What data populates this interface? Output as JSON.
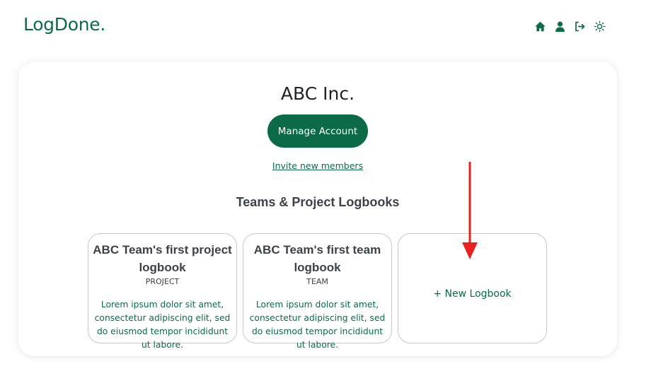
{
  "header": {
    "logo": "LogDone.",
    "nav": [
      {
        "icon": "home-icon"
      },
      {
        "icon": "user-icon"
      },
      {
        "icon": "logout-icon"
      },
      {
        "icon": "sun-icon"
      }
    ]
  },
  "org": {
    "name": "ABC Inc.",
    "manage_label": "Manage Account",
    "invite_label": "Invite new members"
  },
  "logbooks": {
    "section_title": "Teams & Project Logbooks",
    "items": [
      {
        "title": "ABC Team's first project logbook",
        "type": "PROJECT",
        "description": "Lorem ipsum dolor sit amet, consectetur adipiscing elit, sed do eiusmod tempor incididunt ut labore."
      },
      {
        "title": "ABC Team's first team logbook",
        "type": "TEAM",
        "description": "Lorem ipsum dolor sit amet, consectetur adipiscing elit, sed do eiusmod tempor incididunt ut labore."
      }
    ],
    "new_label": "+ New Logbook"
  },
  "colors": {
    "brand": "#0b6b46",
    "annotation_arrow": "#e8231f"
  }
}
